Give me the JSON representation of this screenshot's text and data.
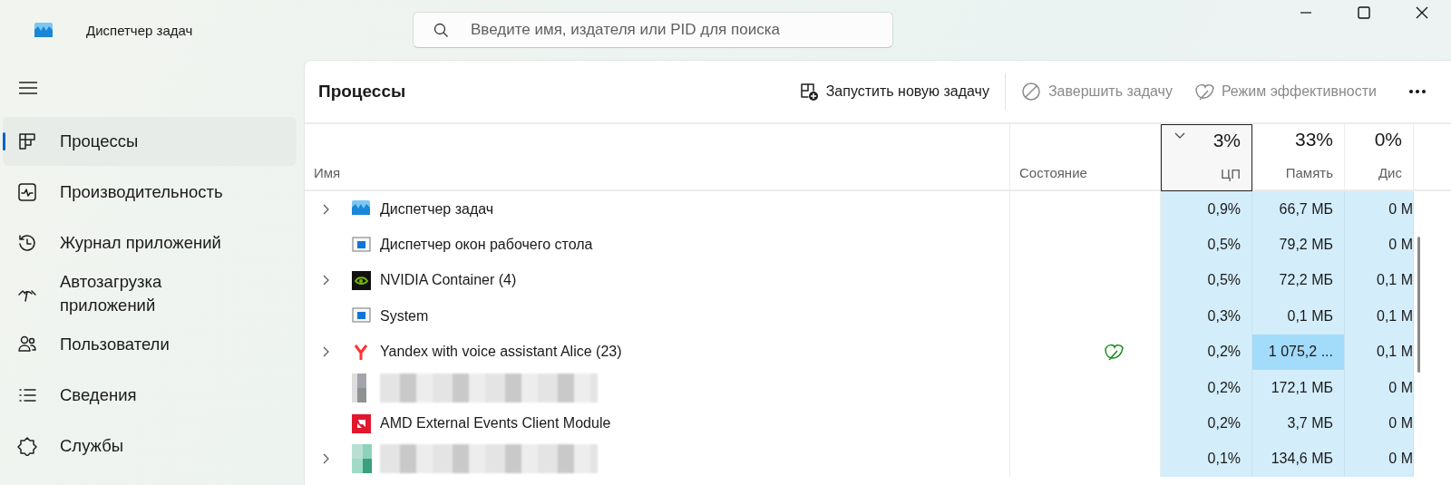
{
  "window": {
    "title": "Диспетчер задач"
  },
  "search": {
    "placeholder": "Введите имя, издателя или PID для поиска"
  },
  "sidebar": {
    "items": [
      {
        "label": "Процессы",
        "selected": true
      },
      {
        "label": "Производительность",
        "selected": false
      },
      {
        "label": "Журнал приложений",
        "selected": false
      },
      {
        "label": "Автозагрузка приложений",
        "selected": false
      },
      {
        "label": "Пользователи",
        "selected": false
      },
      {
        "label": "Сведения",
        "selected": false
      },
      {
        "label": "Службы",
        "selected": false
      }
    ]
  },
  "page": {
    "title": "Процессы"
  },
  "toolbar": [
    {
      "label": "Запустить новую задачу",
      "disabled": false
    },
    {
      "label": "Завершить задачу",
      "disabled": true
    },
    {
      "label": "Режим эффективности",
      "disabled": true
    }
  ],
  "table": {
    "columns": [
      {
        "label": "Имя",
        "sorted": false
      },
      {
        "label": "Состояние",
        "sorted": false
      },
      {
        "total": "3%",
        "label": "ЦП",
        "sorted": true
      },
      {
        "total": "33%",
        "label": "Память",
        "sorted": false
      },
      {
        "total": "0%",
        "label": "Дис",
        "sorted": false
      }
    ],
    "rows": [
      {
        "name": "Диспетчер задач",
        "expandable": true,
        "efficiency": false,
        "cpu": "0,9%",
        "memory": "66,7 МБ",
        "memory_high": false,
        "disk": "0 М"
      },
      {
        "name": "Диспетчер окон рабочего стола",
        "expandable": false,
        "efficiency": false,
        "cpu": "0,5%",
        "memory": "79,2 МБ",
        "memory_high": false,
        "disk": "0 М"
      },
      {
        "name": "NVIDIA Container (4)",
        "expandable": true,
        "efficiency": false,
        "cpu": "0,5%",
        "memory": "72,2 МБ",
        "memory_high": false,
        "disk": "0,1 М"
      },
      {
        "name": "System",
        "expandable": false,
        "efficiency": false,
        "cpu": "0,3%",
        "memory": "0,1 МБ",
        "memory_high": false,
        "disk": "0,1 М"
      },
      {
        "name": "Yandex with voice assistant Alice (23)",
        "expandable": true,
        "efficiency": true,
        "cpu": "0,2%",
        "memory": "1 075,2 ...",
        "memory_high": true,
        "disk": "0,1 М"
      },
      {
        "expandable": false,
        "efficiency": false,
        "cpu": "0,2%",
        "memory": "172,1 МБ",
        "memory_high": false,
        "disk": "0 М"
      },
      {
        "name": "AMD External Events Client Module",
        "expandable": false,
        "efficiency": false,
        "cpu": "0,2%",
        "memory": "3,7 МБ",
        "memory_high": false,
        "disk": "0 М"
      },
      {
        "expandable": true,
        "efficiency": false,
        "cpu": "0,1%",
        "memory": "134,6 МБ",
        "memory_high": false,
        "disk": "0 М"
      }
    ]
  }
}
